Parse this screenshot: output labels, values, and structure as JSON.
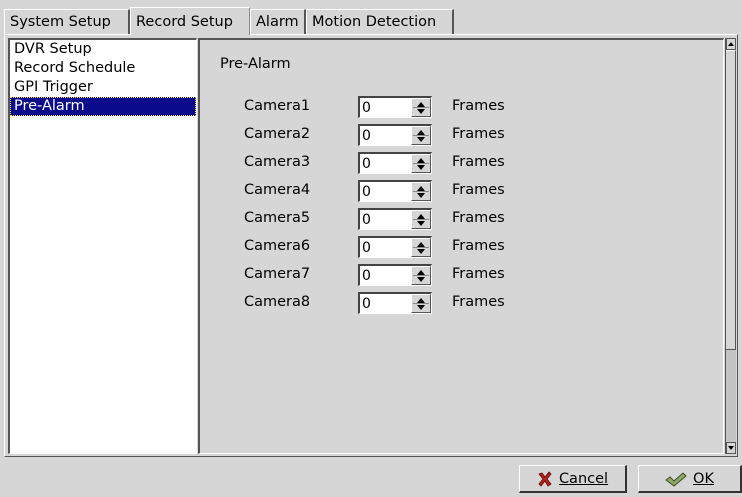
{
  "tabs": [
    {
      "label": "System Setup",
      "active": false
    },
    {
      "label": "Record Setup",
      "active": true
    },
    {
      "label": "Alarm",
      "active": false
    },
    {
      "label": "Motion Detection",
      "active": false
    }
  ],
  "sidebar": {
    "items": [
      {
        "label": "DVR Setup",
        "selected": false
      },
      {
        "label": "Record Schedule",
        "selected": false
      },
      {
        "label": "GPI Trigger",
        "selected": false
      },
      {
        "label": "Pre-Alarm",
        "selected": true
      }
    ]
  },
  "main": {
    "section_title": "Pre-Alarm",
    "unit_label": "Frames",
    "cameras": [
      {
        "label": "Camera1",
        "value": "0"
      },
      {
        "label": "Camera2",
        "value": "0"
      },
      {
        "label": "Camera3",
        "value": "0"
      },
      {
        "label": "Camera4",
        "value": "0"
      },
      {
        "label": "Camera5",
        "value": "0"
      },
      {
        "label": "Camera6",
        "value": "0"
      },
      {
        "label": "Camera7",
        "value": "0"
      },
      {
        "label": "Camera8",
        "value": "0"
      }
    ]
  },
  "buttons": {
    "cancel_label": "Cancel",
    "ok_label": "OK"
  },
  "icons": {
    "cancel": "x-icon",
    "ok": "checkmark-icon"
  },
  "colors": {
    "background": "#d6d6d6",
    "selection": "#0a0a8c",
    "list_background": "#ffffff"
  }
}
